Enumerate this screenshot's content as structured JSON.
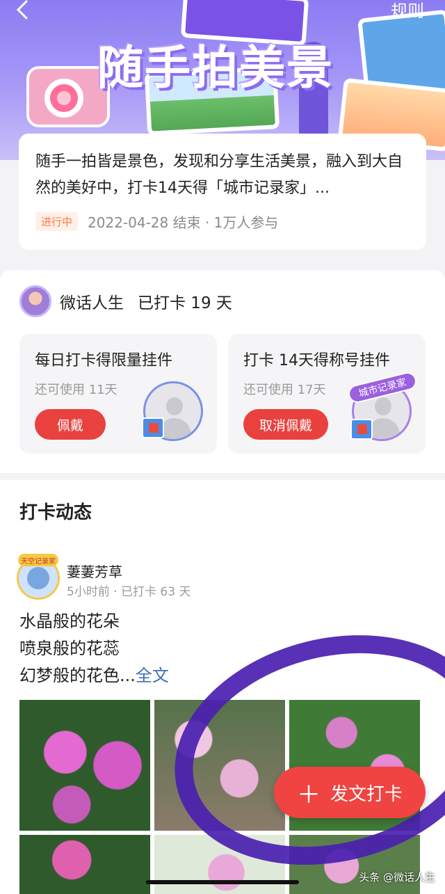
{
  "header": {
    "title": "随手拍美景",
    "rules_label": "规则",
    "back_icon": "chevron-left-icon"
  },
  "intro": {
    "description": "随手一拍皆是景色，发现和分享生活美景，融入到大自然的美好中，打卡14天得「城市记录家」...",
    "status": "进行中",
    "end_info": "2022-04-28 结束 · 1万人参与"
  },
  "user": {
    "name": "微话人生",
    "checkin": "已打卡 19 天"
  },
  "rewards": [
    {
      "title": "每日打卡得限量挂件",
      "remaining": "还可使用 11天",
      "button": "佩戴"
    },
    {
      "title": "打卡 14天得称号挂件",
      "remaining": "还可使用 17天",
      "button": "取消佩戴",
      "banner": "城市记录家"
    }
  ],
  "feed": {
    "title": "打卡动态",
    "post": {
      "user": "萋萋芳草",
      "badge": "天空记录家",
      "meta": "5小时前 · 已打卡 63 天",
      "lines": [
        "水晶般的花朵",
        "喷泉般的花蕊",
        "幻梦般的花色..."
      ],
      "more": "全文"
    }
  },
  "fab": {
    "label": "发文打卡",
    "icon": "plus-icon"
  },
  "watermark": "头条 @微话人生",
  "colors": {
    "accent_red": "#ef4441",
    "banner_purple": "#8b7cf3",
    "status_orange": "#ff7a3c"
  }
}
